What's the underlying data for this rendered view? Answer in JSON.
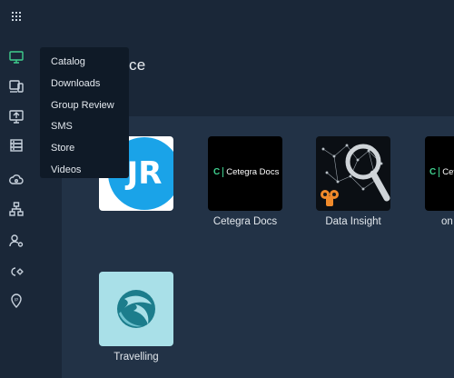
{
  "header": {
    "title_fragment": "ce"
  },
  "menu": {
    "items": [
      {
        "label": "Catalog"
      },
      {
        "label": "Downloads"
      },
      {
        "label": "Group Review"
      },
      {
        "label": "SMS"
      },
      {
        "label": "Store"
      },
      {
        "label": "Videos"
      }
    ]
  },
  "apps": [
    {
      "name": "JR",
      "label": "",
      "logo_text": "JR"
    },
    {
      "name": "cetegra-docs",
      "label": "Cetegra Docs",
      "logo_text": "Cetegra Docs",
      "logo_mark": "C"
    },
    {
      "name": "data-insight",
      "label": "Data Insight"
    },
    {
      "name": "cetegra-online",
      "label": "on",
      "logo_text": "Cetegra",
      "logo_mark": "C"
    },
    {
      "name": "travelling",
      "label": "Travelling"
    }
  ],
  "colors": {
    "rail_bg": "#1a2738",
    "content_bg": "#223246",
    "accent_green": "#3fcf8e",
    "jr_blue": "#1aa3e8",
    "travel_bg": "#a9e0e8"
  },
  "rail_icons": [
    "apps-grid-icon",
    "monitor-icon",
    "devices-icon",
    "presentation-icon",
    "server-icon",
    "cloud-icon",
    "network-icon",
    "user-settings-icon",
    "code-settings-icon",
    "location-pin-icon"
  ]
}
